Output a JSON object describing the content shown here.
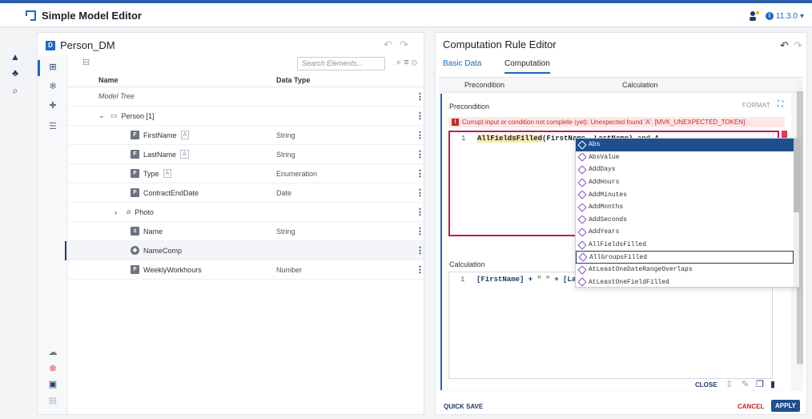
{
  "app": {
    "title": "Simple Model Editor",
    "version": "11.3.0"
  },
  "left_panel": {
    "badge": "D",
    "title": "Person_DM",
    "search_placeholder": "Search Elements...",
    "columns": [
      "Name",
      "Data Type"
    ],
    "rows": [
      {
        "name": "Model Tree",
        "type": "",
        "indent": 0,
        "kind": "root"
      },
      {
        "name": "Person [1]",
        "type": "",
        "indent": 1,
        "kind": "folder"
      },
      {
        "name": "FirstName",
        "badge": "A",
        "type": "String",
        "indent": 2,
        "kind": "field"
      },
      {
        "name": "LastName",
        "badge": "A",
        "type": "String",
        "indent": 2,
        "kind": "field"
      },
      {
        "name": "Type",
        "badge": "A",
        "type": "Enumeration",
        "indent": 2,
        "kind": "field"
      },
      {
        "name": "ContractEndDate",
        "type": "Date",
        "indent": 2,
        "kind": "field"
      },
      {
        "name": "Photo",
        "type": "",
        "indent": 1,
        "kind": "attachment"
      },
      {
        "name": "Name",
        "type": "String",
        "indent": 2,
        "kind": "computed"
      },
      {
        "name": "NameComp",
        "type": "",
        "indent": 2,
        "kind": "comp"
      },
      {
        "name": "WeeklyWorkhours",
        "type": "Number",
        "indent": 2,
        "kind": "field"
      }
    ]
  },
  "right_panel": {
    "title": "Computation Rule Editor",
    "tabs": [
      "Basic Data",
      "Computation"
    ],
    "sub_headers": [
      "Precondition",
      "Calculation"
    ],
    "precondition_label": "Precondition",
    "format_label": "FORMAT",
    "error": "Corrupt input or condition not complete (yet): Unexpected found 'A'. [MVK_UNEXPECTED_TOKEN]",
    "editor1": {
      "line": "1",
      "code_fn": "AllFieldsFilled",
      "code_args": "(FirstName, LastName)",
      "code_kw": " and ",
      "code_tail": "A"
    },
    "calculation_label": "Calculation",
    "editor2": {
      "line": "1",
      "code_a": "[FirstName] + ",
      "code_str": "\" \"",
      "code_b": " + [La"
    },
    "autocomplete": [
      "Abs",
      "AbsValue",
      "AddDays",
      "AddHours",
      "AddMinutes",
      "AddMonths",
      "AddSeconds",
      "AddYears",
      "AllFieldsFilled",
      "AllGroupsFilled",
      "AtLeastOneDateRangeOverlaps",
      "AtLeastOneFieldFilled"
    ],
    "close_label": "CLOSE",
    "quick_save": "QUICK SAVE",
    "cancel": "CANCEL",
    "apply": "APPLY"
  }
}
